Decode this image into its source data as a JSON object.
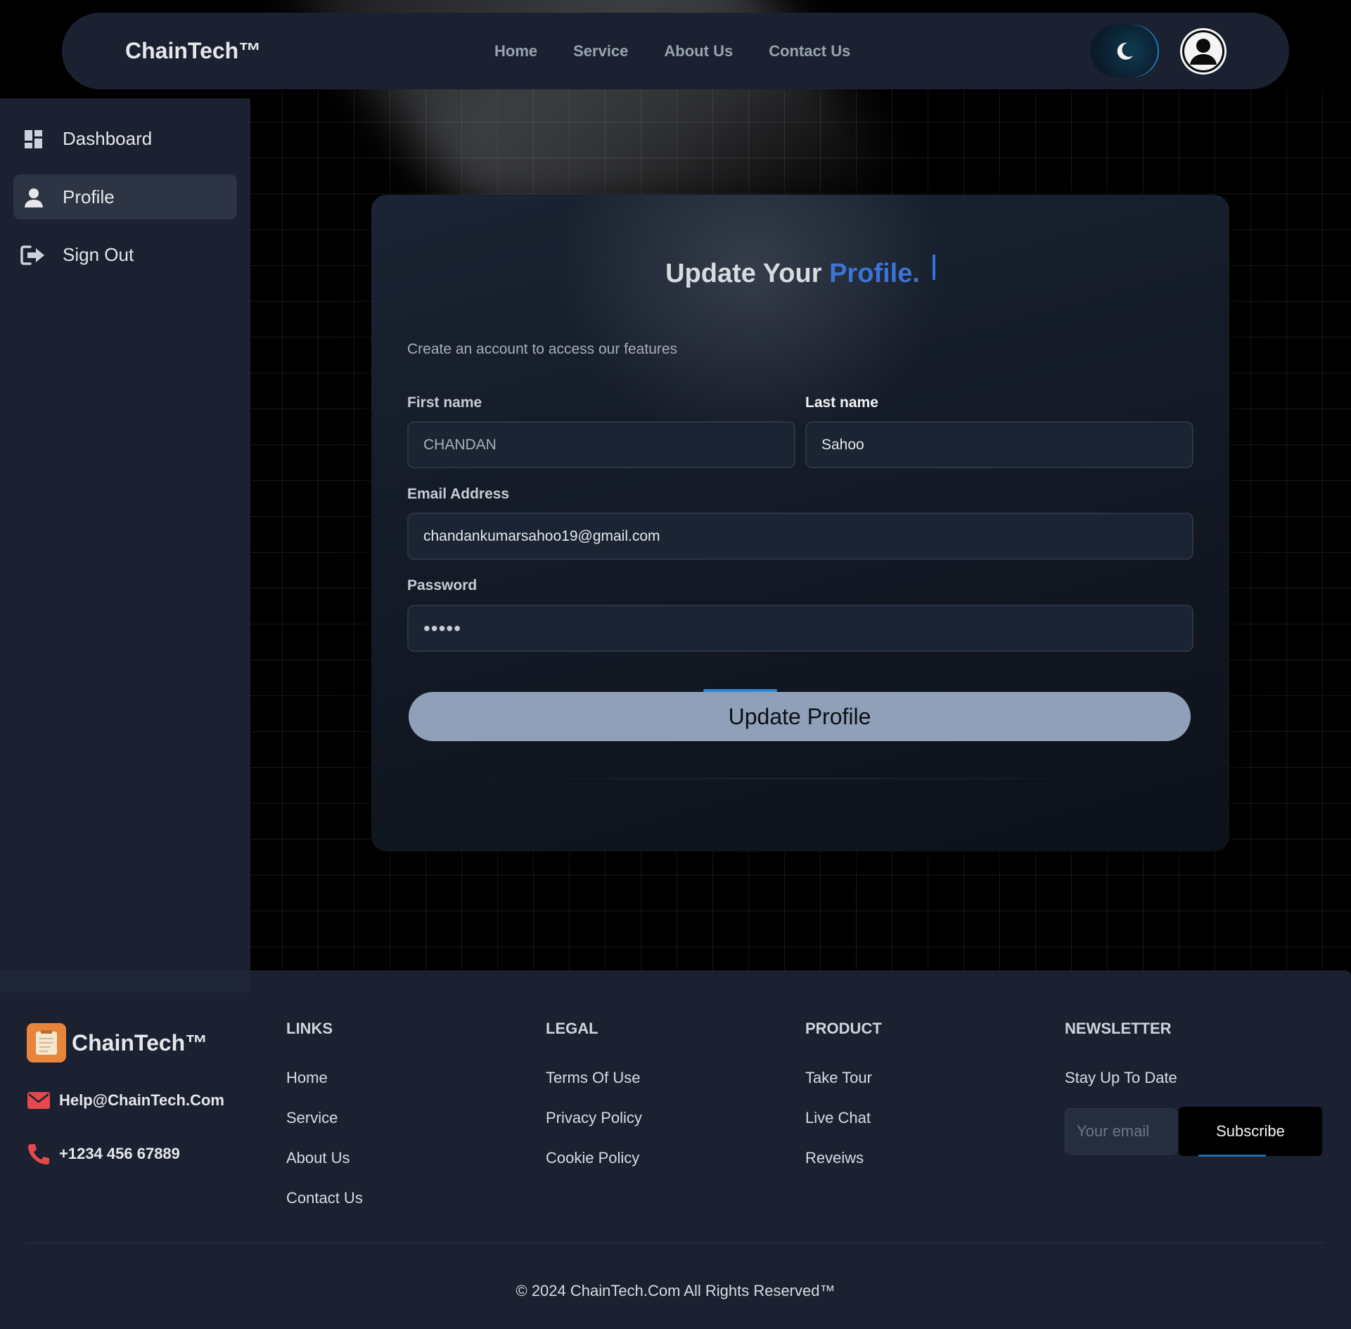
{
  "navbar": {
    "brand": "ChainTech™",
    "links": [
      "Home",
      "Service",
      "About Us",
      "Contact Us"
    ]
  },
  "sidebar": {
    "items": [
      {
        "label": "Dashboard",
        "icon": "dashboard-icon"
      },
      {
        "label": "Profile",
        "icon": "user-icon",
        "active": true
      },
      {
        "label": "Sign Out",
        "icon": "sign-out-icon"
      }
    ]
  },
  "form": {
    "title_prefix": "Update Your",
    "title_accent": "Profile.",
    "subtitle": "Create an account to access our features",
    "first_name_label": "First name",
    "first_name_value": "CHANDAN",
    "last_name_label": "Last name",
    "last_name_value": "Sahoo",
    "email_label": "Email Address",
    "email_value": "chandankumarsahoo19@gmail.com",
    "password_label": "Password",
    "password_value": "•••••",
    "submit_label": "Update Profile"
  },
  "footer": {
    "brand": "ChainTech™",
    "email": "Help@ChainTech.Com",
    "phone": "+1234 456 67889",
    "columns": [
      {
        "heading": "LINKS",
        "items": [
          "Home",
          "Service",
          "About Us",
          "Contact Us"
        ]
      },
      {
        "heading": "LEGAL",
        "items": [
          "Terms Of Use",
          "Privacy Policy",
          "Cookie Policy"
        ]
      },
      {
        "heading": "PRODUCT",
        "items": [
          "Take Tour",
          "Live Chat",
          "Reveiws"
        ]
      }
    ],
    "newsletter": {
      "heading": "NEWSLETTER",
      "text": "Stay Up To Date",
      "placeholder": "Your email",
      "button": "Subscribe"
    },
    "copyright": "© 2024 ChainTech.Com All Rights Reserved™"
  },
  "colors": {
    "accent": "#3b74d4",
    "panel": "#1b2130",
    "button": "#8fa0b8",
    "logo_box": "#e8843c",
    "contact_icon": "#e5484d"
  }
}
